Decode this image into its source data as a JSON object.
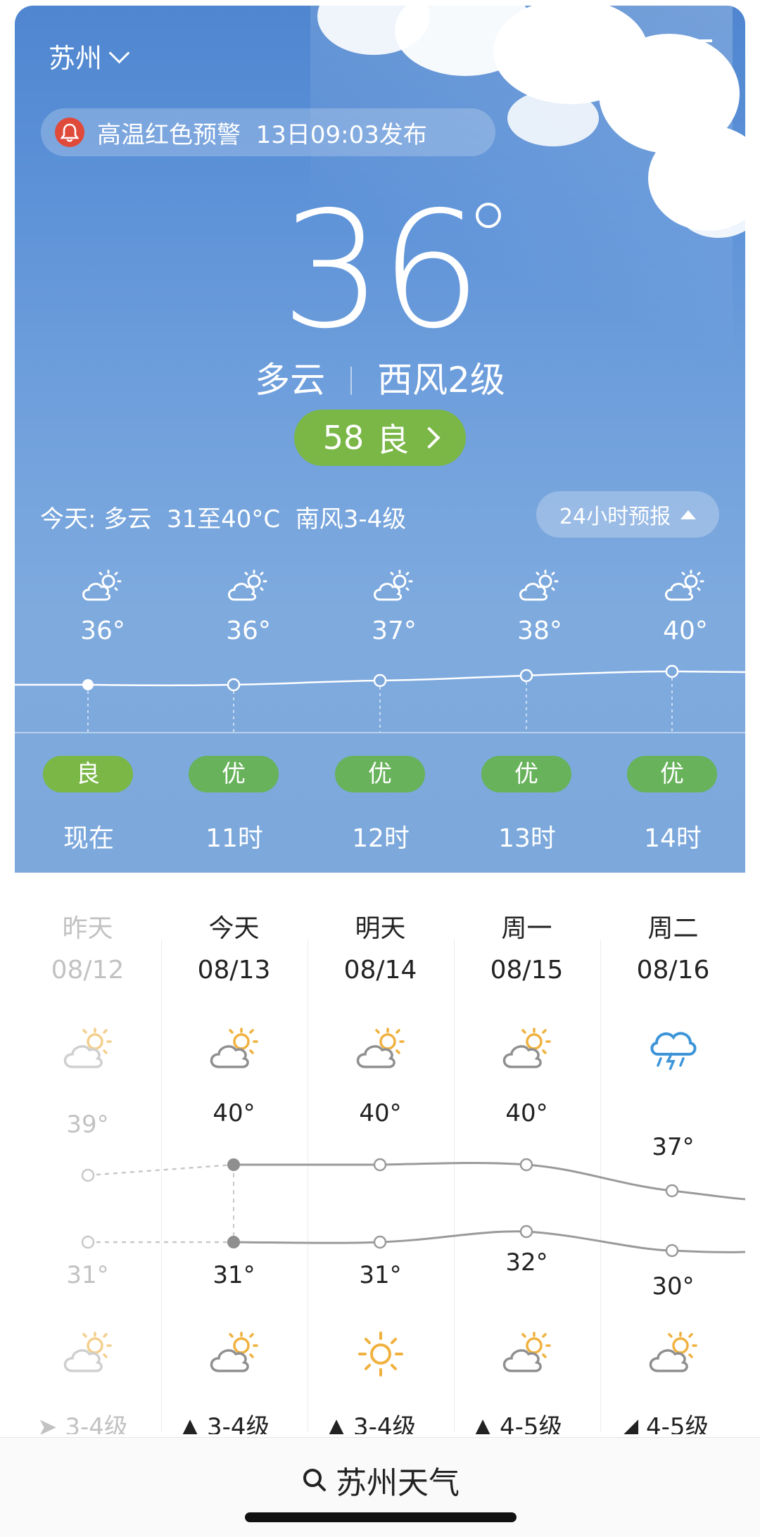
{
  "header": {
    "city": "苏州",
    "share_icon": "share-icon",
    "menu_icon": "list-menu-icon"
  },
  "alert": {
    "text": "高温红色预警  13日09:03发布",
    "icon": "bell-icon",
    "icon_color": "#e04a3b"
  },
  "current": {
    "temp": "36",
    "condition": "多云",
    "wind": "西风2级",
    "aqi_value": "58",
    "aqi_label": "良",
    "aqi_color": "#7ab746"
  },
  "today_summary": "今天: 多云  31至40°C  南风3-4级",
  "forecast_toggle": "24小时预报",
  "hourly": [
    {
      "temp": "36°",
      "aq": "良",
      "label": "现在"
    },
    {
      "temp": "36°",
      "aq": "优",
      "label": "11时"
    },
    {
      "temp": "37°",
      "aq": "优",
      "label": "12时"
    },
    {
      "temp": "38°",
      "aq": "优",
      "label": "13时"
    },
    {
      "temp": "40°",
      "aq": "优",
      "label": "14时"
    }
  ],
  "daily": [
    {
      "name": "昨天",
      "date": "08/12",
      "hi": "39°",
      "lo": "31°",
      "wind": "3-4级",
      "day_icon": "partly-cloudy-icon",
      "night_icon": "partly-cloudy-icon"
    },
    {
      "name": "今天",
      "date": "08/13",
      "hi": "40°",
      "lo": "31°",
      "wind": "3-4级",
      "day_icon": "partly-cloudy-icon",
      "night_icon": "partly-cloudy-icon"
    },
    {
      "name": "明天",
      "date": "08/14",
      "hi": "40°",
      "lo": "31°",
      "wind": "3-4级",
      "day_icon": "partly-cloudy-icon",
      "night_icon": "sunny-icon"
    },
    {
      "name": "周一",
      "date": "08/15",
      "hi": "40°",
      "lo": "32°",
      "wind": "4-5级",
      "day_icon": "partly-cloudy-icon",
      "night_icon": "partly-cloudy-icon"
    },
    {
      "name": "周二",
      "date": "08/16",
      "hi": "37°",
      "lo": "30°",
      "wind": "4-5级",
      "day_icon": "thunderstorm-icon",
      "night_icon": "partly-cloudy-icon"
    }
  ],
  "bottom": {
    "search_text": "苏州天气"
  }
}
